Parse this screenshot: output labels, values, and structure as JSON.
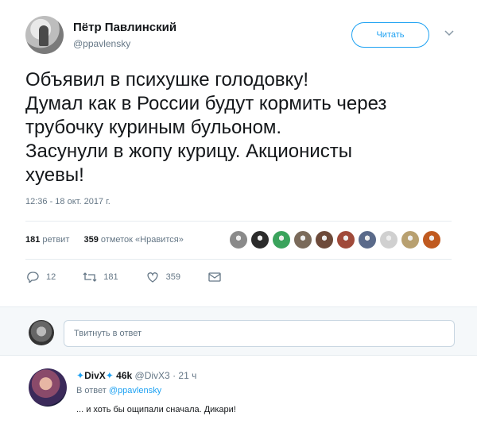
{
  "tweet": {
    "author_name": "Пётр Павлинский",
    "author_handle": "@ppavlensky",
    "follow_label": "Читать",
    "text_lines": [
      "Объявил в психушке голодовку!",
      "Думал как в России будут кормить через",
      "трубочку куриным бульоном.",
      "Засунули в жопу курицу. Акционисты",
      "хуевы!"
    ],
    "timestamp": "12:36 - 18 окт. 2017 г.",
    "retweets_count": "181",
    "retweets_label": "ретвит",
    "likes_count": "359",
    "likes_label": "отметок «Нравится»",
    "liker_avatar_colors": [
      "#8a8a8a",
      "#2b2b2b",
      "#3aa35c",
      "#7a6a5a",
      "#6d4a3a",
      "#a04a3a",
      "#5a6a8a",
      "#d0d0d0",
      "#b8a070",
      "#c05a20"
    ],
    "actions": {
      "reply_count": "12",
      "retweet_count": "181",
      "like_count": "359"
    }
  },
  "reply_box": {
    "placeholder": "Твитнуть в ответ"
  },
  "reply": {
    "author_name": "DivX",
    "followers": "46k",
    "handle": "@DivX3",
    "time": "21 ч",
    "reply_to_label": "В ответ",
    "reply_to_handle": "@ppavlensky",
    "text": "... и хоть бы ощипали сначала. Дикари!"
  },
  "colors": {
    "accent": "#1da1f2",
    "muted": "#657786",
    "text": "#14171a",
    "border": "#e6ecf0"
  }
}
